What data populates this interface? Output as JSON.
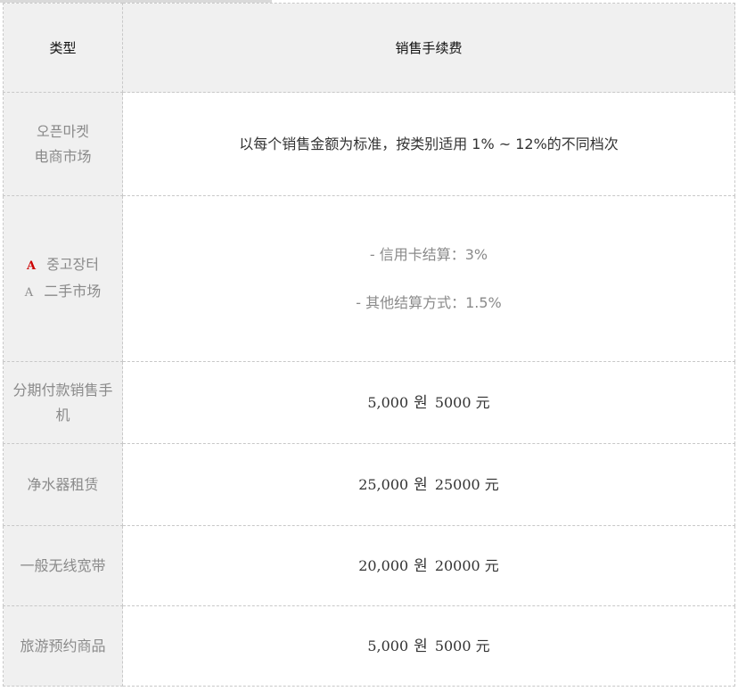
{
  "table": {
    "header": {
      "type_label": "类型",
      "fee_label": "销售手续费"
    },
    "rows": [
      {
        "category_lines": [
          "오픈마켓",
          "电商市场"
        ],
        "fee_lines": [
          "以每个销售金额为标准，按类别适用 1% ~ 12%的不同档次"
        ]
      },
      {
        "category_marks": [
          "A",
          "A"
        ],
        "category_lines": [
          "중고장터",
          "二手市场"
        ],
        "fee_lines": [
          "-  信用卡结算：3%",
          "-  其他结算方式：1.5%"
        ]
      },
      {
        "category_lines": [
          "分期付款销售手机"
        ],
        "fee_amount": "5,000",
        "fee_won": "원",
        "fee_cny": "5000 元"
      },
      {
        "category_lines": [
          "净水器租赁"
        ],
        "fee_amount": "25,000",
        "fee_won": "원",
        "fee_cny": "25000 元"
      },
      {
        "category_lines": [
          "一般无线宽带"
        ],
        "fee_amount": "20,000",
        "fee_won": "원",
        "fee_cny": "20000 元"
      },
      {
        "category_lines": [
          "旅游预约商品"
        ],
        "fee_amount": "5,000",
        "fee_won": "원",
        "fee_cny": "5000 元"
      }
    ]
  },
  "colors": {
    "header_bg": "#f0f0f0",
    "category_bg": "#f0f0f0",
    "border": "#c8c8c8",
    "mark_red": "#cc0000"
  }
}
